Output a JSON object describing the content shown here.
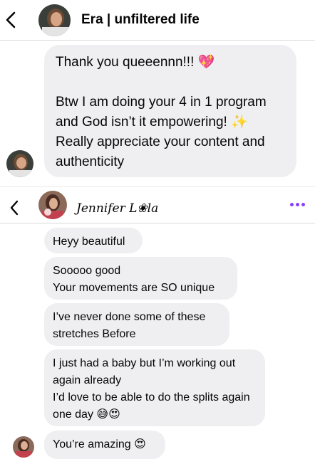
{
  "thread1": {
    "name": "Era | unfiltered life",
    "message": "Thank you queeennn!!! 💖\n\nBtw I am doing your 4 in 1 program and God isn’t it empowering! ✨\nReally appreciate your content and authenticity"
  },
  "thread2": {
    "name": "Jennifer L❀la",
    "messages": [
      "Heyy beautiful",
      "Sooooo good\nYour movements are SO unique",
      "I’ve never done some of these stretches Before",
      "I just had a baby but I’m working out again already\nI’d love to be able to do the splits again one day 😅😍",
      "You’re amazing 😍"
    ]
  },
  "icons": {
    "back": "chevron-left-icon",
    "more": "more-horizontal-icon"
  },
  "colors": {
    "bubble": "#efeff1",
    "accent": "#8a3ffc"
  }
}
